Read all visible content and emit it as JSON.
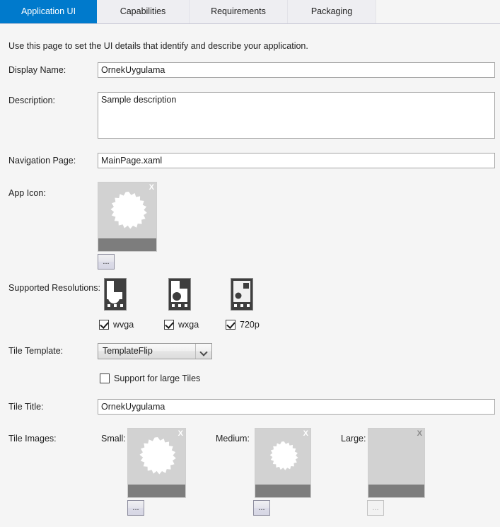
{
  "tabs": [
    {
      "label": "Application UI",
      "active": true
    },
    {
      "label": "Capabilities",
      "active": false
    },
    {
      "label": "Requirements",
      "active": false
    },
    {
      "label": "Packaging",
      "active": false
    }
  ],
  "intro": "Use this page to set the UI details that identify and describe your application.",
  "fields": {
    "display_name": {
      "label": "Display Name:",
      "value": "OrnekUygulama"
    },
    "description": {
      "label": "Description:",
      "value": "Sample description"
    },
    "navigation_page": {
      "label": "Navigation Page:",
      "value": "MainPage.xaml"
    },
    "app_icon": {
      "label": "App Icon:"
    },
    "supported_resolutions": {
      "label": "Supported Resolutions:"
    },
    "tile_template": {
      "label": "Tile Template:",
      "value": "TemplateFlip"
    },
    "support_large_tiles": {
      "label": "Support for large Tiles",
      "checked": false
    },
    "tile_title": {
      "label": "Tile Title:",
      "value": "OrnekUygulama"
    },
    "tile_images": {
      "label": "Tile Images:"
    }
  },
  "resolutions": [
    {
      "label": "wvga",
      "checked": true
    },
    {
      "label": "wxga",
      "checked": true
    },
    {
      "label": "720p",
      "checked": true
    }
  ],
  "tiles": [
    {
      "label": "Small:",
      "has_image": true
    },
    {
      "label": "Medium:",
      "has_image": true
    },
    {
      "label": "Large:",
      "has_image": false
    }
  ],
  "buttons": {
    "browse_label": "...",
    "clear_label": "X"
  },
  "colors": {
    "accent": "#007acc",
    "page_bg": "#f5f5f5",
    "tab_inactive_bg": "#eeeef2",
    "preview_bg": "#d2d2d2",
    "preview_footer": "#7d7d7d",
    "input_border": "#a5a5a5"
  }
}
